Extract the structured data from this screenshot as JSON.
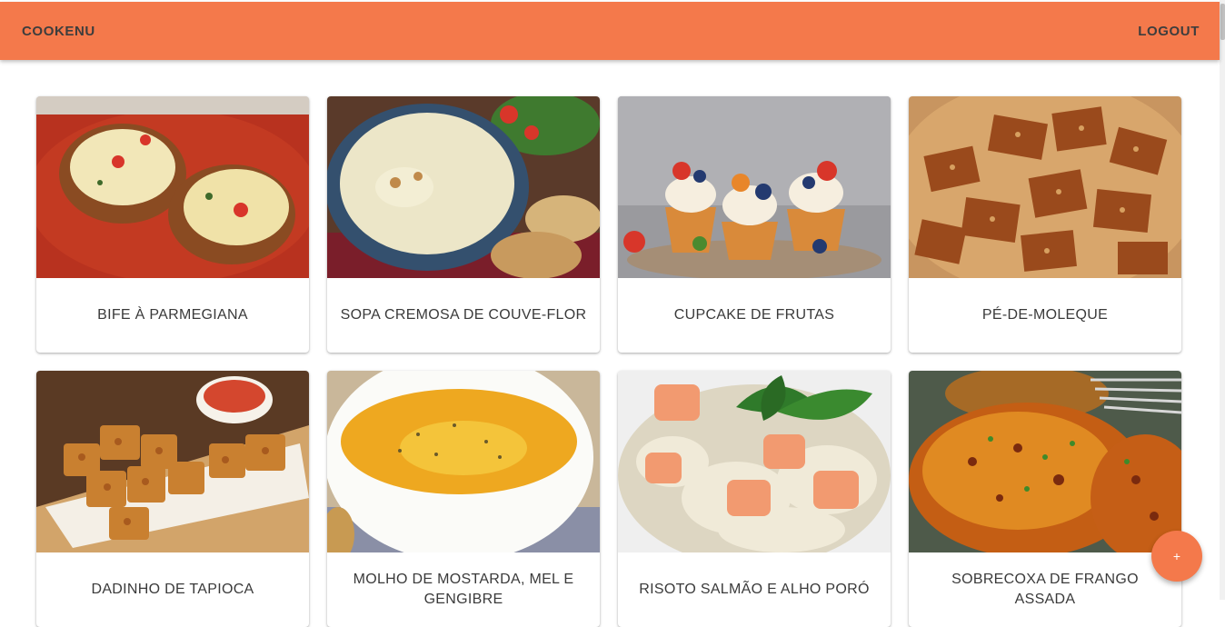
{
  "appbar": {
    "brand_label": "COOKENU",
    "logout_label": "LOGOUT",
    "color": "#f4794b"
  },
  "recipes": [
    {
      "title": "BIFE À PARMEGIANA"
    },
    {
      "title": "SOPA CREMOSA DE COUVE-FLOR"
    },
    {
      "title": "CUPCAKE DE FRUTAS"
    },
    {
      "title": "PÉ-DE-MOLEQUE"
    },
    {
      "title": "DADINHO DE TAPIOCA"
    },
    {
      "title": "MOLHO DE MOSTARDA, MEL E GENGIBRE"
    },
    {
      "title": "RISOTO SALMÃO E ALHO PORÓ"
    },
    {
      "title": "SOBRECOXA DE FRANGO ASSADA"
    }
  ],
  "fab": {
    "label": "+"
  }
}
